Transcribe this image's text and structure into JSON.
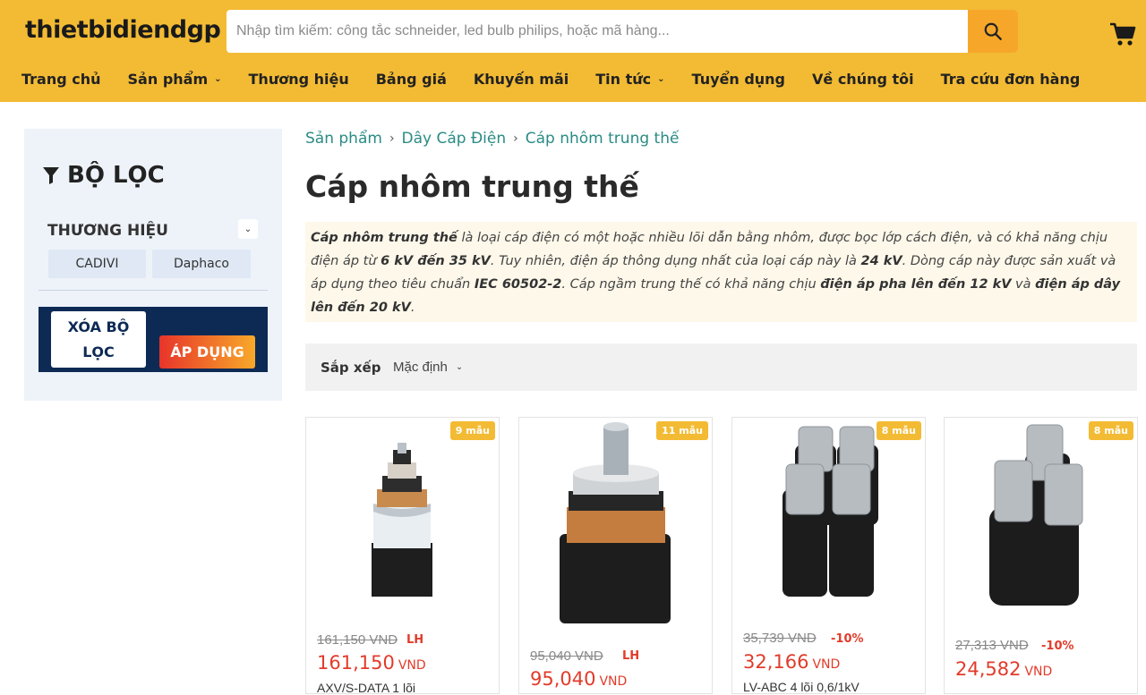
{
  "header": {
    "logo": "thietbidiendgp",
    "search_placeholder": "Nhập tìm kiếm: công tắc schneider, led bulb philips, hoặc mã hàng...",
    "nav": [
      {
        "label": "Trang chủ",
        "dropdown": false
      },
      {
        "label": "Sản phẩm",
        "dropdown": true
      },
      {
        "label": "Thương hiệu",
        "dropdown": false
      },
      {
        "label": "Bảng giá",
        "dropdown": false
      },
      {
        "label": "Khuyến mãi",
        "dropdown": false
      },
      {
        "label": "Tin tức",
        "dropdown": true
      },
      {
        "label": "Tuyển dụng",
        "dropdown": false
      },
      {
        "label": "Về chúng tôi",
        "dropdown": false
      },
      {
        "label": "Tra cứu đơn hàng",
        "dropdown": false
      }
    ],
    "colors": {
      "bar": "#f3bb34",
      "search_button": "#f6a72a"
    }
  },
  "sidebar": {
    "title": "BỘ LỌC",
    "brand_heading": "THƯƠNG HIỆU",
    "brands": [
      "CADIVI",
      "Daphaco"
    ],
    "clear_label_1": "XÓA BỘ",
    "clear_label_2": "LỌC",
    "apply_label": "ÁP DỤNG"
  },
  "breadcrumb": [
    "Sản phẩm",
    "Dây Cáp Điện",
    "Cáp nhôm trung thế"
  ],
  "page_title": "Cáp nhôm trung thế",
  "description": {
    "p1_bold": "Cáp nhôm trung thế",
    "p1": " là loại cáp điện có một hoặc nhiều lõi dẫn bằng nhôm, được bọc lớp cách điện, và có khả năng chịu điện áp từ ",
    "p2_bold": "6 kV đến 35 kV",
    "p2": ". Tuy nhiên, điện áp thông dụng nhất của loại cáp này là ",
    "p3_bold": "24 kV",
    "p3": ". Dòng cáp này được sản xuất và áp dụng theo tiêu chuẩn ",
    "p4_bold": "IEC 60502-2",
    "p4": ". Cáp ngầm trung thế có khả năng chịu ",
    "p5_bold": "điện áp pha lên đến 12 kV",
    "p5": " và ",
    "p6_bold": "điện áp dây lên đến 20 kV",
    "p6": "."
  },
  "sort": {
    "label": "Sắp xếp",
    "value": "Mặc định"
  },
  "products": [
    {
      "badge": "9 mẫu",
      "old_price": "161,150 VND",
      "tag": "LH",
      "price": "161,150",
      "currency": "VND",
      "name": "AXV/S-DATA 1 lõi"
    },
    {
      "badge": "11 mẫu",
      "old_price": "95,040 VND",
      "tag": "LH",
      "price": "95,040",
      "currency": "VND",
      "name": ""
    },
    {
      "badge": "8 mẫu",
      "old_price": "35,739 VND",
      "tag": "-10%",
      "price": "32,166",
      "currency": "VND",
      "name": "LV-ABC 4 lõi 0,6/1kV"
    },
    {
      "badge": "8 mẫu",
      "old_price": "27,313 VND",
      "tag": "-10%",
      "price": "24,582",
      "currency": "VND",
      "name": ""
    }
  ]
}
